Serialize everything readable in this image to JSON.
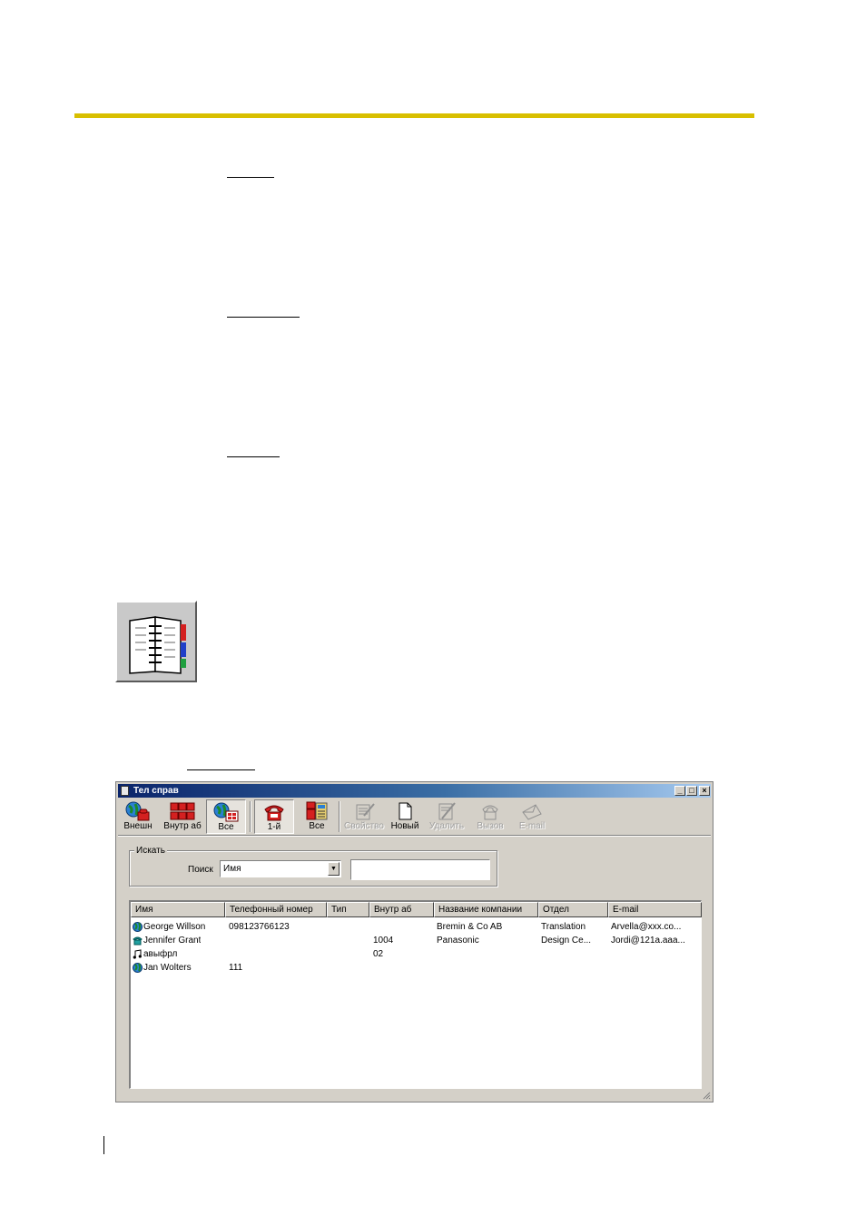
{
  "window": {
    "title": "Тел справ",
    "caption_buttons": {
      "minimize": "_",
      "maximize": "□",
      "close": "×"
    }
  },
  "toolbar": {
    "buttons": [
      {
        "label": "Внешн",
        "icon": "globe-phone-icon",
        "state": "normal"
      },
      {
        "label": "Внутр аб",
        "icon": "extensions-icon",
        "state": "normal"
      },
      {
        "label": "Все",
        "icon": "globe-grid-icon",
        "state": "pressed"
      },
      {
        "label": "1-й",
        "icon": "red-phone-icon",
        "state": "pressed"
      },
      {
        "label": "Все",
        "icon": "multi-phone-icon",
        "state": "normal"
      },
      {
        "label": "Свойство",
        "icon": "properties-icon",
        "state": "disabled"
      },
      {
        "label": "Новый",
        "icon": "new-document-icon",
        "state": "normal"
      },
      {
        "label": "Удалить",
        "icon": "delete-icon",
        "state": "disabled"
      },
      {
        "label": "Вызов",
        "icon": "call-icon",
        "state": "disabled"
      },
      {
        "label": "E-mail",
        "icon": "email-icon",
        "state": "disabled"
      }
    ]
  },
  "search": {
    "group_label": "Искать",
    "field_label": "Поиск",
    "selected_field": "Имя",
    "text_value": ""
  },
  "contacts": {
    "columns": [
      "Имя",
      "Телефонный номер",
      "Тип",
      "Внутр аб",
      "Название компании",
      "Отдел",
      "E-mail"
    ],
    "rows": [
      {
        "icon": "globe-icon",
        "name": "George Willson",
        "phone": "098123766123",
        "type": "",
        "ext": "",
        "company": "Bremin & Co AB",
        "dept": "Translation",
        "email": "Arvella@xxx.co..."
      },
      {
        "icon": "phone-icon",
        "name": "Jennifer Grant",
        "phone": "",
        "type": "",
        "ext": "1004",
        "company": "Panasonic",
        "dept": "Design Ce...",
        "email": "Jordi@121a.aaa..."
      },
      {
        "icon": "music-note-icon",
        "name": "авыфрл",
        "phone": "",
        "type": "",
        "ext": "02",
        "company": "",
        "dept": "",
        "email": ""
      },
      {
        "icon": "globe-icon",
        "name": "Jan Wolters",
        "phone": "111",
        "type": "",
        "ext": "",
        "company": "",
        "dept": "",
        "email": ""
      }
    ]
  },
  "colors": {
    "accent_rule": "#d8bf00",
    "title_bar": "#0a246a"
  }
}
